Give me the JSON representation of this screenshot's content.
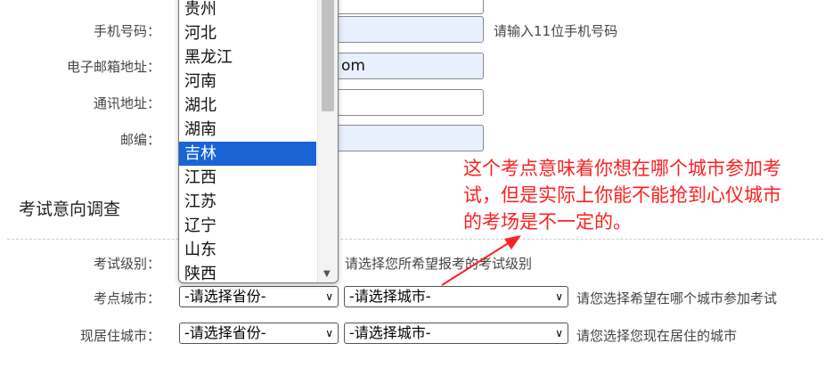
{
  "form": {
    "phone": {
      "label": "手机号码：",
      "hint": "请输入11位手机号码",
      "value": ""
    },
    "email": {
      "label": "电子邮箱地址：",
      "value_fragment": "om"
    },
    "address": {
      "label": "通讯地址："
    },
    "zip": {
      "label": "邮编："
    }
  },
  "exam": {
    "section_title": "考试意向调查",
    "level": {
      "label": "考试级别：",
      "hint": "请选择您所希望报考的考试级别"
    },
    "exam_city": {
      "label": "考点城市：",
      "province_select": "-请选择省份-",
      "city_select": "-请选择城市-",
      "hint": "请您选择希望在哪个城市参加考试"
    },
    "residence_city": {
      "label": "现居住城市：",
      "province_select": "-请选择省份-",
      "city_select": "-请选择城市-",
      "hint": "请您选择您现在居住的城市"
    }
  },
  "province_dropdown": {
    "options": [
      "贵州",
      "河北",
      "黑龙江",
      "河南",
      "湖北",
      "湖南",
      "吉林",
      "江西",
      "江苏",
      "辽宁",
      "山东",
      "陕西"
    ],
    "highlighted": "吉林"
  },
  "annotation": {
    "text": "这个考点意味着你想在哪个城市参加考试，但是实际上你能不能抢到心仪城市的考场是不一定的。",
    "color": "#ff1f1f"
  },
  "colors": {
    "highlight": "#1a64d6",
    "autofill": "#e8f0fe"
  }
}
